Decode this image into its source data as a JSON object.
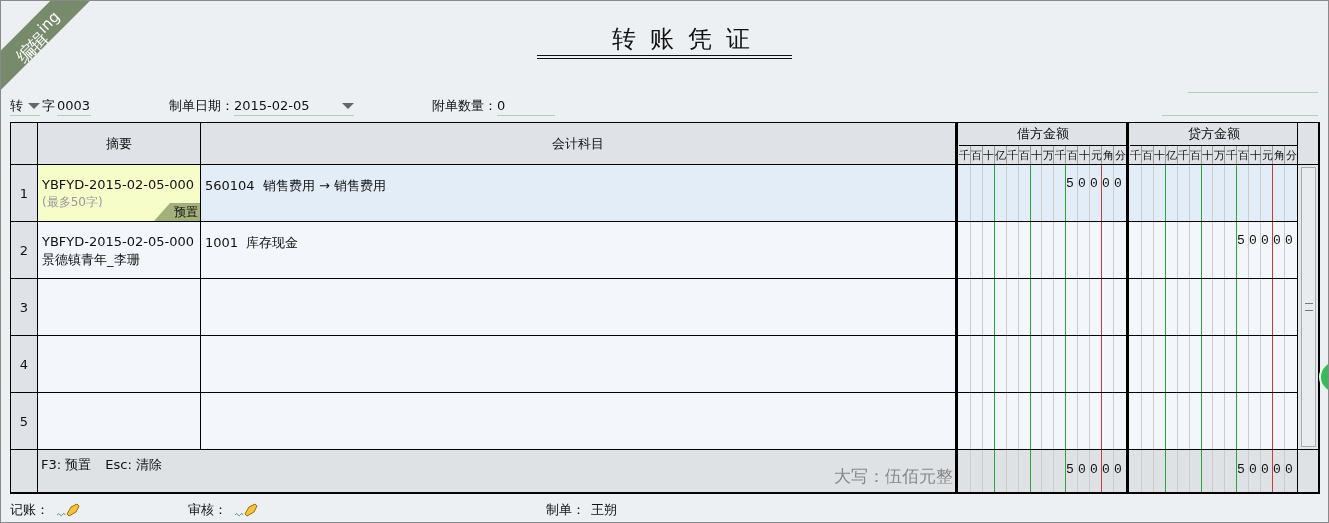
{
  "status_ribbon": "编辑$^{ing}$",
  "title": "转账凭证",
  "meta": {
    "voucher_type": "转",
    "voucher_word": "字",
    "voucher_number": "0003",
    "date_label": "制单日期：",
    "date": "2015-02-05",
    "attachments_label": "附单数量：",
    "attachments": "0"
  },
  "columns": [
    "摘要",
    "会计科目"
  ],
  "amount_columns": [
    {
      "title": "借方金额",
      "units": "千百十亿千百十万千百十元角分"
    },
    {
      "title": "贷方金额",
      "units": "千百十亿千百十万千百十元角分"
    }
  ],
  "rows": [
    {
      "index": "1",
      "selected": true,
      "summary": "YBFYD-2015-02-05-000",
      "summary_hint": "(最多50字)",
      "preset_tag": "预置",
      "account": "560104  销售费用 → 销售费用",
      "debit": "50000"
    },
    {
      "index": "2",
      "selected": false,
      "summary": "YBFYD-2015-02-05-000",
      "summary_note": "景德镇青年_李珊",
      "account": "1001  库存现金",
      "credit": "50000"
    },
    {
      "index": "3",
      "selected": false
    },
    {
      "index": "4",
      "selected": false
    },
    {
      "index": "5",
      "selected": false
    }
  ],
  "footer": {
    "hotkeys": [
      "F3: 预置",
      "Esc: 清除"
    ],
    "amount_in_words": "大写：伍佰元整",
    "debit_total": "50000",
    "credit_total": "50000"
  },
  "signatures": [
    {
      "label": "记账：",
      "kind": "pen"
    },
    {
      "label": "审核：",
      "kind": "pen"
    },
    {
      "label": "制单：",
      "kind": "name",
      "value": "王朔"
    }
  ]
}
